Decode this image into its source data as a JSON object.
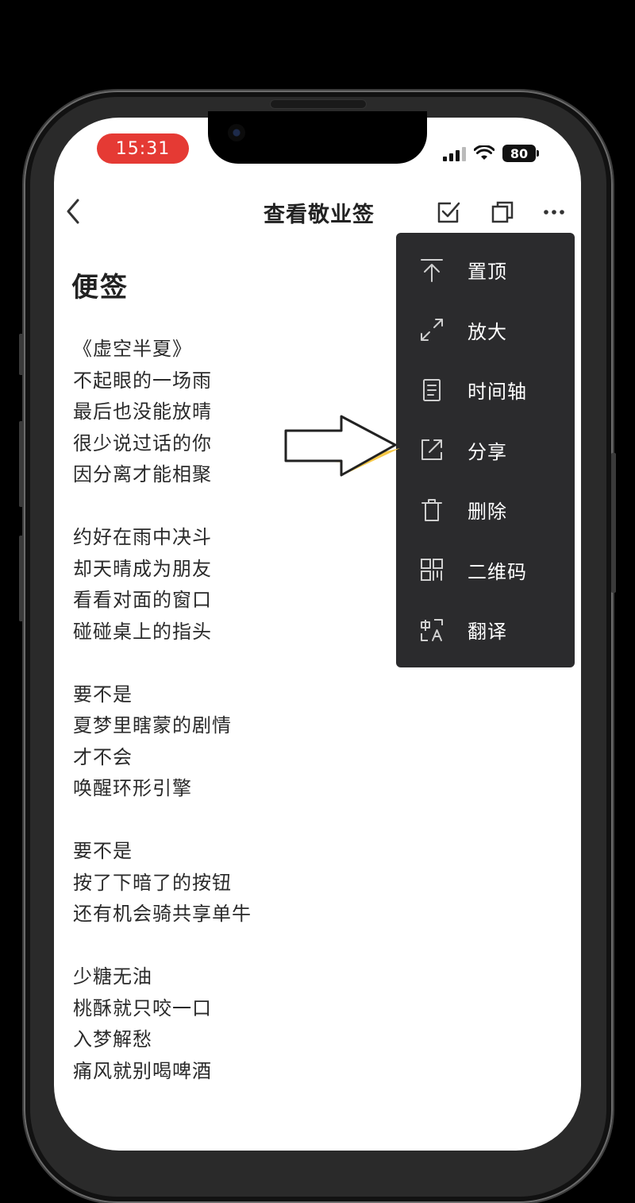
{
  "status_bar": {
    "time": "15:31",
    "battery": "80"
  },
  "nav": {
    "title": "查看敬业签"
  },
  "note": {
    "heading": "便签",
    "lines": [
      "《虚空半夏》",
      "不起眼的一场雨",
      "最后也没能放晴",
      "很少说过话的你",
      "因分离才能相聚",
      "",
      "约好在雨中决斗",
      "却天晴成为朋友",
      "看看对面的窗口",
      "碰碰桌上的指头",
      "",
      "要不是",
      "夏梦里瞎蒙的剧情",
      "才不会",
      "唤醒环形引擎",
      "",
      "要不是",
      "按了下暗了的按钮",
      "还有机会骑共享单牛",
      "",
      "少糖无油",
      "桃酥就只咬一口",
      "入梦解愁",
      "痛风就别喝啤酒"
    ]
  },
  "menu": {
    "items": [
      {
        "label": "置顶",
        "icon": "pin-top-icon"
      },
      {
        "label": "放大",
        "icon": "expand-icon"
      },
      {
        "label": "时间轴",
        "icon": "timeline-icon"
      },
      {
        "label": "分享",
        "icon": "share-icon"
      },
      {
        "label": "删除",
        "icon": "trash-icon"
      },
      {
        "label": "二维码",
        "icon": "qrcode-icon"
      },
      {
        "label": "翻译",
        "icon": "translate-icon"
      }
    ]
  },
  "colors": {
    "time_pill": "#e53a34",
    "menu_bg": "#2b2b2d",
    "annotation_highlight": "#f7c948"
  }
}
